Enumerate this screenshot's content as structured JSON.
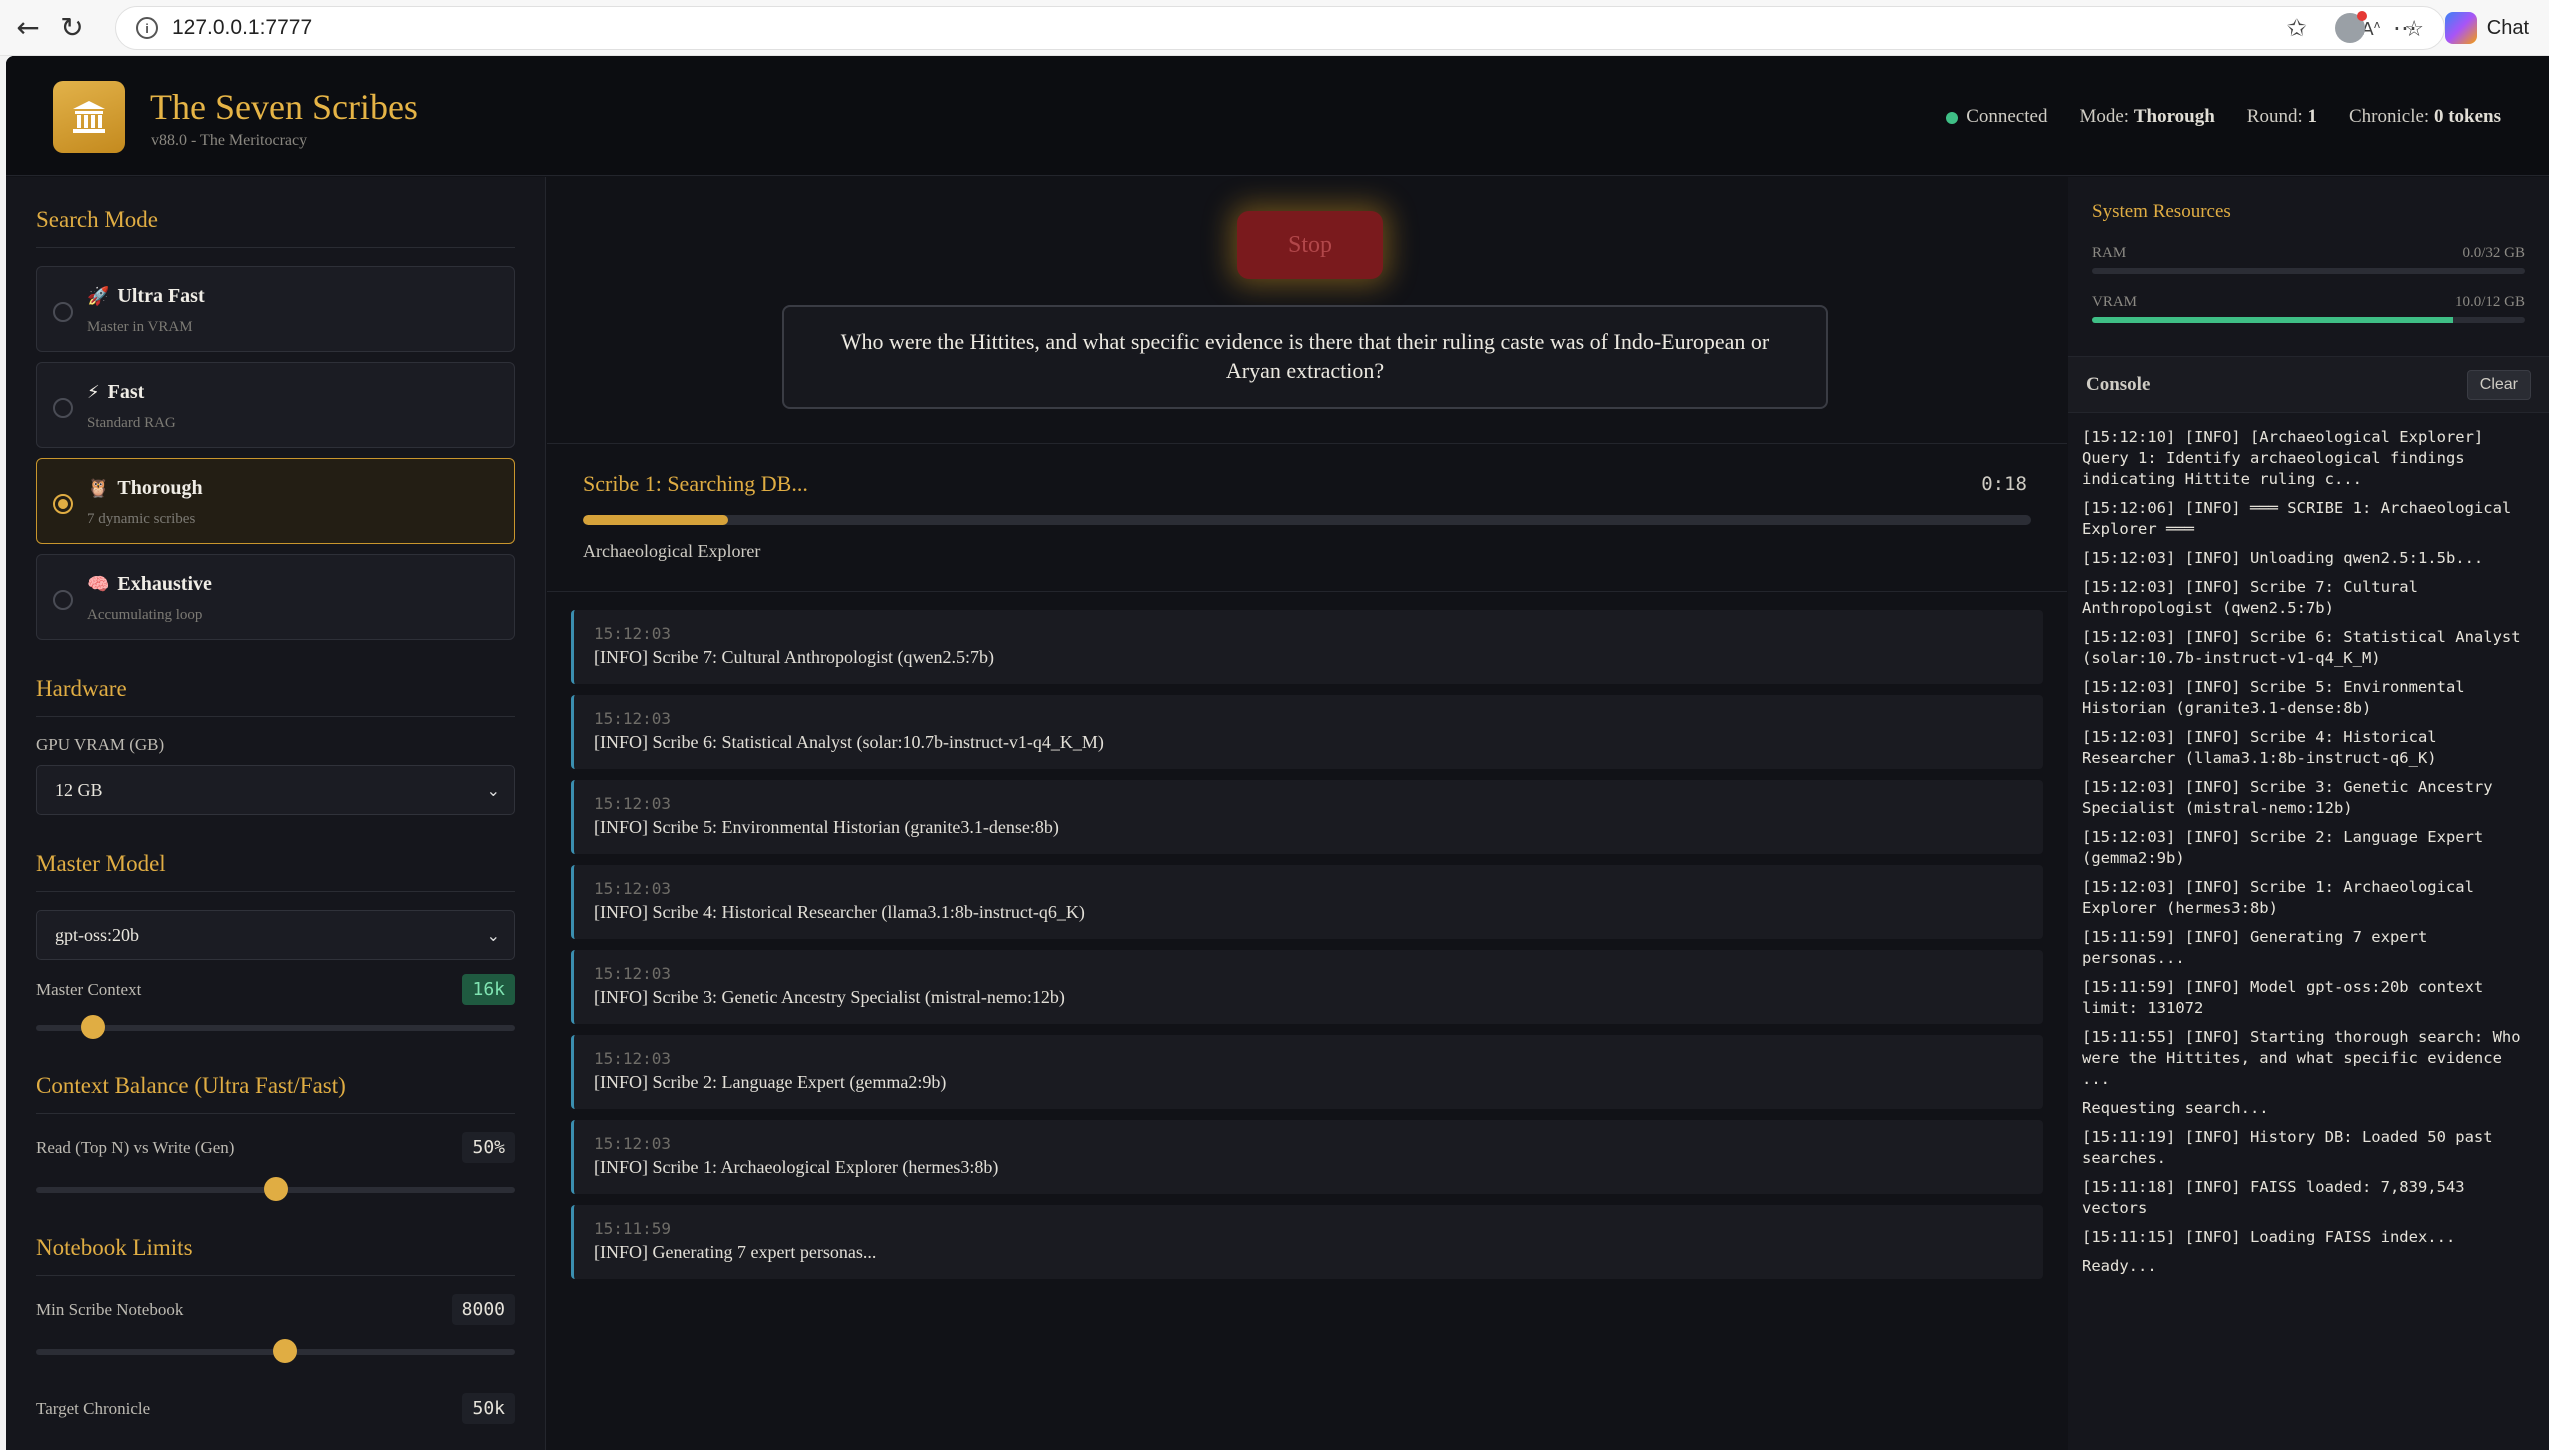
{
  "browser": {
    "url": "127.0.0.1:7777",
    "chat_label": "Chat"
  },
  "header": {
    "title": "The Seven Scribes",
    "subtitle": "v88.0 - The Meritocracy",
    "status": "Connected",
    "mode_label": "Mode:",
    "mode_value": "Thorough",
    "round_label": "Round:",
    "round_value": "1",
    "chronicle_label": "Chronicle:",
    "chronicle_value": "0 tokens"
  },
  "sidebar": {
    "search_mode_title": "Search Mode",
    "modes": [
      {
        "icon": "rocket-icon",
        "glyph": "🚀",
        "name": "Ultra Fast",
        "desc": "Master in VRAM",
        "active": false
      },
      {
        "icon": "lightning-icon",
        "glyph": "⚡",
        "name": "Fast",
        "desc": "Standard RAG",
        "active": false
      },
      {
        "icon": "owl-icon",
        "glyph": "🦉",
        "name": "Thorough",
        "desc": "7 dynamic scribes",
        "active": true
      },
      {
        "icon": "brain-icon",
        "glyph": "🧠",
        "name": "Exhaustive",
        "desc": "Accumulating loop",
        "active": false
      }
    ],
    "hardware_title": "Hardware",
    "gpu_label": "GPU VRAM (GB)",
    "gpu_value": "12 GB",
    "master_model_title": "Master Model",
    "master_model_value": "gpt-oss:20b",
    "master_context_label": "Master Context",
    "master_context_value": "16k",
    "master_context_slider": 0.12,
    "context_balance_title": "Context Balance (Ultra Fast/Fast)",
    "read_write_label": "Read (Top N) vs Write (Gen)",
    "read_write_value": "50%",
    "read_write_slider": 0.5,
    "notebook_title": "Notebook Limits",
    "min_notebook_label": "Min Scribe Notebook",
    "min_notebook_value": "8000",
    "min_notebook_slider": 0.52,
    "target_chronicle_label": "Target Chronicle",
    "target_chronicle_value": "50k"
  },
  "center": {
    "stop_label": "Stop",
    "query": "Who were the Hittites, and what specific evidence is there that their ruling caste was of Indo-European or Aryan extraction?",
    "progress_title": "Scribe 1: Searching DB...",
    "timer": "0:18",
    "progress": 0.1,
    "scribe_name": "Archaeological Explorer",
    "logs": [
      {
        "time": "15:12:03",
        "msg": "[INFO] Scribe 7: Cultural Anthropologist (qwen2.5:7b)"
      },
      {
        "time": "15:12:03",
        "msg": "[INFO] Scribe 6: Statistical Analyst (solar:10.7b-instruct-v1-q4_K_M)"
      },
      {
        "time": "15:12:03",
        "msg": "[INFO] Scribe 5: Environmental Historian (granite3.1-dense:8b)"
      },
      {
        "time": "15:12:03",
        "msg": "[INFO] Scribe 4: Historical Researcher (llama3.1:8b-instruct-q6_K)"
      },
      {
        "time": "15:12:03",
        "msg": "[INFO] Scribe 3: Genetic Ancestry Specialist (mistral-nemo:12b)"
      },
      {
        "time": "15:12:03",
        "msg": "[INFO] Scribe 2: Language Expert (gemma2:9b)"
      },
      {
        "time": "15:12:03",
        "msg": "[INFO] Scribe 1: Archaeological Explorer (hermes3:8b)"
      },
      {
        "time": "15:11:59",
        "msg": "[INFO] Generating 7 expert personas..."
      }
    ]
  },
  "right": {
    "resources_title": "System Resources",
    "ram_label": "RAM",
    "ram_value": "0.0/32 GB",
    "ram_fraction": 0.0,
    "vram_label": "VRAM",
    "vram_value": "10.0/12 GB",
    "vram_fraction": 0.833,
    "console_title": "Console",
    "clear_label": "Clear",
    "console_lines": [
      "[15:12:10] [INFO] [Archaeological Explorer] Query 1: Identify archaeological findings indicating Hittite ruling c...",
      "[15:12:06] [INFO] ═══ SCRIBE 1: Archaeological Explorer ═══",
      "[15:12:03] [INFO] Unloading qwen2.5:1.5b...",
      "[15:12:03] [INFO] Scribe 7: Cultural Anthropologist (qwen2.5:7b)",
      "[15:12:03] [INFO] Scribe 6: Statistical Analyst (solar:10.7b-instruct-v1-q4_K_M)",
      "[15:12:03] [INFO] Scribe 5: Environmental Historian (granite3.1-dense:8b)",
      "[15:12:03] [INFO] Scribe 4: Historical Researcher (llama3.1:8b-instruct-q6_K)",
      "[15:12:03] [INFO] Scribe 3: Genetic Ancestry Specialist (mistral-nemo:12b)",
      "[15:12:03] [INFO] Scribe 2: Language Expert (gemma2:9b)",
      "[15:12:03] [INFO] Scribe 1: Archaeological Explorer (hermes3:8b)",
      "[15:11:59] [INFO] Generating 7 expert personas...",
      "[15:11:59] [INFO] Model gpt-oss:20b context limit: 131072",
      "[15:11:55] [INFO] Starting thorough search: Who were the Hittites, and what specific evidence ...",
      "Requesting search...",
      "[15:11:19] [INFO] History DB: Loaded 50 past searches.",
      "[15:11:18] [INFO] FAISS loaded: 7,839,543 vectors",
      "[15:11:15] [INFO] Loading FAISS index...",
      "Ready..."
    ]
  },
  "colors": {
    "accent": "#e0ad43",
    "connected": "#3fbf86",
    "stop": "#7a1a1d"
  }
}
